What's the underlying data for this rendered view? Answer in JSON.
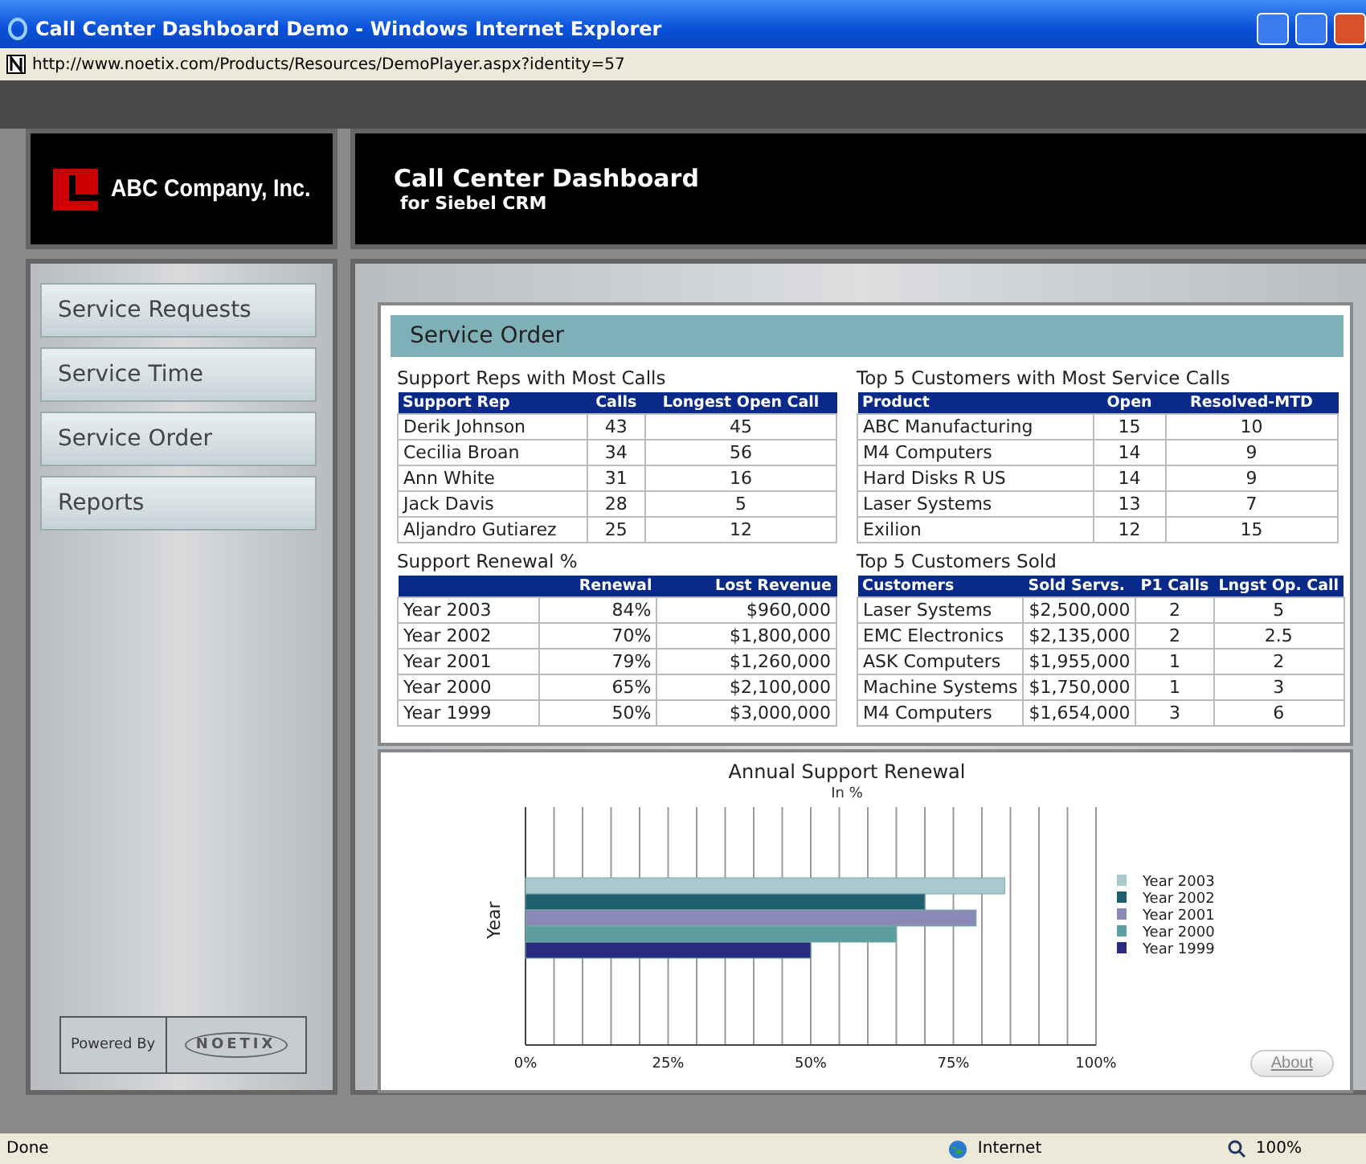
{
  "window": {
    "title": "Call Center Dashboard Demo - Windows Internet Explorer",
    "url": "http://www.noetix.com/Products/Resources/DemoPlayer.aspx?identity=57"
  },
  "header": {
    "company": "ABC Company, Inc.",
    "title": "Call Center Dashboard",
    "subtitle": "for Siebel CRM"
  },
  "sidebar": {
    "items": [
      {
        "label": "Service Requests"
      },
      {
        "label": "Service Time"
      },
      {
        "label": "Service Order"
      },
      {
        "label": "Reports"
      }
    ],
    "powered_by": "Powered By",
    "partner": "NOETIX"
  },
  "panel": {
    "title": "Service Order"
  },
  "tables": [
    {
      "title": "Support Reps with Most Calls",
      "columns": [
        "Support Rep",
        "Calls",
        "Longest Open Call"
      ],
      "rows": [
        [
          "Derik Johnson",
          "43",
          "45"
        ],
        [
          "Cecilia Broan",
          "34",
          "56"
        ],
        [
          "Ann White",
          "31",
          "16"
        ],
        [
          "Jack Davis",
          "28",
          "5"
        ],
        [
          "Aljandro Gutiarez",
          "25",
          "12"
        ]
      ]
    },
    {
      "title": "Top 5 Customers with Most Service Calls",
      "columns": [
        "Product",
        "Open",
        "Resolved-MTD"
      ],
      "rows": [
        [
          "ABC Manufacturing",
          "15",
          "10"
        ],
        [
          "M4 Computers",
          "14",
          "9"
        ],
        [
          "Hard Disks R US",
          "14",
          "9"
        ],
        [
          "Laser Systems",
          "13",
          "7"
        ],
        [
          "Exilion",
          "12",
          "15"
        ]
      ]
    },
    {
      "title": "Support Renewal %",
      "columns": [
        "",
        "Renewal",
        "Lost Revenue"
      ],
      "rows": [
        [
          "Year 2003",
          "84%",
          "$960,000"
        ],
        [
          "Year 2002",
          "70%",
          "$1,800,000"
        ],
        [
          "Year 2001",
          "79%",
          "$1,260,000"
        ],
        [
          "Year 2000",
          "65%",
          "$2,100,000"
        ],
        [
          "Year 1999",
          "50%",
          "$3,000,000"
        ]
      ]
    },
    {
      "title": "Top 5 Customers Sold",
      "columns": [
        "Customers",
        "Sold Servs.",
        "P1 Calls",
        "Lngst Op. Call"
      ],
      "rows": [
        [
          "Laser Systems",
          "$2,500,000",
          "2",
          "5"
        ],
        [
          "EMC Electronics",
          "$2,135,000",
          "2",
          "2.5"
        ],
        [
          "ASK Computers",
          "$1,955,000",
          "1",
          "2"
        ],
        [
          "Machine Systems",
          "$1,750,000",
          "1",
          "3"
        ],
        [
          "M4 Computers",
          "$1,654,000",
          "3",
          "6"
        ]
      ]
    }
  ],
  "chart_data": {
    "type": "bar",
    "orientation": "horizontal",
    "title": "Annual Support Renewal",
    "subtitle": "In %",
    "ylabel": "Year",
    "grid": true,
    "legend": true,
    "xlim": [
      0,
      100
    ],
    "xticks": [
      {
        "value": 0,
        "label": "0%"
      },
      {
        "value": 25,
        "label": "25%"
      },
      {
        "value": 50,
        "label": "50%"
      },
      {
        "value": 75,
        "label": "75%"
      },
      {
        "value": 100,
        "label": "100%"
      }
    ],
    "series": [
      {
        "name": "Year 2003",
        "color": "#a9c9cc",
        "values": [
          84
        ]
      },
      {
        "name": "Year 2002",
        "color": "#1f5f70",
        "values": [
          70
        ]
      },
      {
        "name": "Year 2001",
        "color": "#8a89b8",
        "values": [
          79
        ]
      },
      {
        "name": "Year 2000",
        "color": "#5f9ea0",
        "values": [
          65
        ]
      },
      {
        "name": "Year 1999",
        "color": "#2a2a80",
        "values": [
          50
        ]
      }
    ]
  },
  "about_button": "About",
  "status_bar": {
    "status": "Done",
    "zone": "Internet",
    "zoom": "100%"
  }
}
